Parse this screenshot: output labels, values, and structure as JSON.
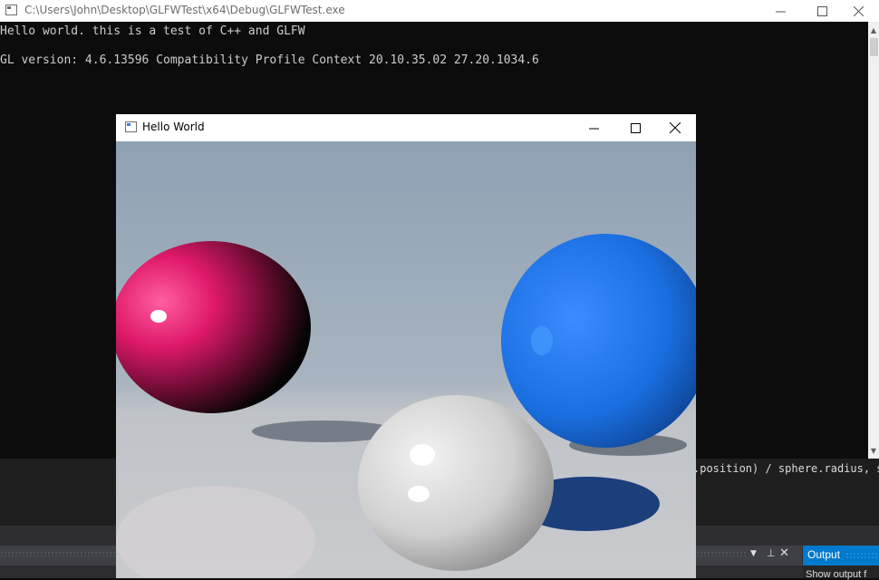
{
  "console": {
    "title": "C:\\Users\\John\\Desktop\\GLFWTest\\x64\\Debug\\GLFWTest.exe",
    "lines": [
      "Hello world. this is a test of C++ and GLFW",
      "GL version: 4.6.13596 Compatibility Profile Context 20.10.35.02 27.20.1034.6"
    ],
    "buttons": {
      "minimize": "minimize-icon",
      "maximize": "maximize-icon",
      "close": "close-icon"
    }
  },
  "glfw_window": {
    "title": "Hello World",
    "scene": {
      "spheres": [
        {
          "name": "pink-sphere",
          "color": "#e0196a"
        },
        {
          "name": "blue-sphere",
          "color": "#1a6fe0"
        },
        {
          "name": "white-sphere",
          "color": "#d8d8d8"
        }
      ],
      "sky_color": "#8ea1b3",
      "floor_color": "#c9cbcf"
    }
  },
  "vs": {
    "code_fragment": ".position) / sphere.radius, sph",
    "output_tab_label": "Output",
    "show_output_label": "Show output f",
    "accent": "#007acc"
  }
}
